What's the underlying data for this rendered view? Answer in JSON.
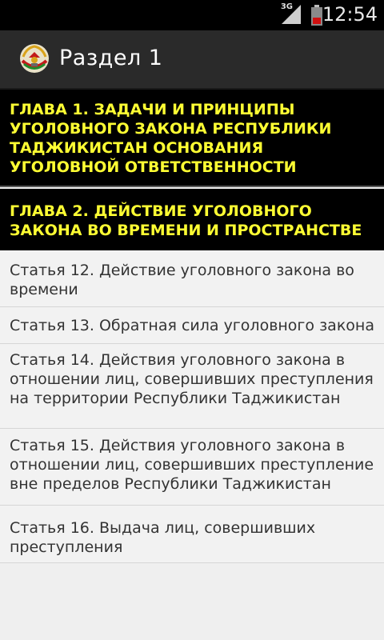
{
  "status_bar": {
    "network": "3G",
    "time": "12:54"
  },
  "action_bar": {
    "title": "Раздел 1",
    "icon": "tajikistan-emblem-icon"
  },
  "chapters": [
    {
      "label": "ГЛАВА 1. ЗАДАЧИ И ПРИНЦИПЫ УГОЛОВНОГО ЗАКОНА РЕСПУБЛИКИ ТАДЖИКИСТАН ОСНОВАНИЯ  УГОЛОВНОЙ ОТВЕТСТВЕННОСТИ"
    },
    {
      "label": "ГЛАВА 2. ДЕЙСТВИЕ УГОЛОВНОГО ЗАКОНА ВО ВРЕМЕНИ И ПРОСТРАНСТВЕ"
    }
  ],
  "articles": [
    {
      "label": "Статья 12. Действие уголовного закона во времени"
    },
    {
      "label": "Статья 13. Обратная сила уголовного закона"
    },
    {
      "label": "Статья 14. Действия уголовного закона в отношении лиц, совершивших преступления на территории Республики Таджикистан"
    },
    {
      "label": "Статья 15. Действия уголовного закона в отношении лиц, совершивших преступление вне пределов Республики Таджикистан"
    },
    {
      "label": "Статья 16. Выдача лиц, совершивших преступления"
    }
  ],
  "colors": {
    "chapter_text": "#ffff33",
    "chapter_bg": "#000000",
    "action_bar_bg": "#2a2a2a",
    "list_bg": "#f2f2f2"
  }
}
